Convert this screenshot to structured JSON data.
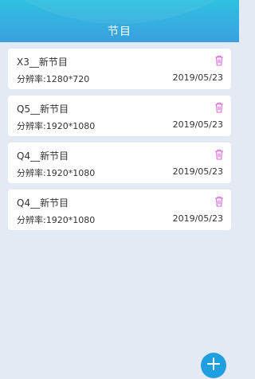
{
  "header": {
    "title": "节目"
  },
  "programs": [
    {
      "name": "X3__新节目",
      "resolution": "分辨率:1280*720",
      "date": "2019/05/23"
    },
    {
      "name": "Q5__新节目",
      "resolution": "分辨率:1920*1080",
      "date": "2019/05/23"
    },
    {
      "name": "Q4__新节目",
      "resolution": "分辨率:1920*1080",
      "date": "2019/05/23"
    },
    {
      "name": "Q4__新节目",
      "resolution": "分辨率:1920*1080",
      "date": "2019/05/23"
    }
  ],
  "icons": {
    "delete": "trash-icon",
    "add": "plus-icon"
  },
  "colors": {
    "header": "#35b0e0",
    "accent": "#1f9ee0",
    "trash": "#d86bd8"
  }
}
